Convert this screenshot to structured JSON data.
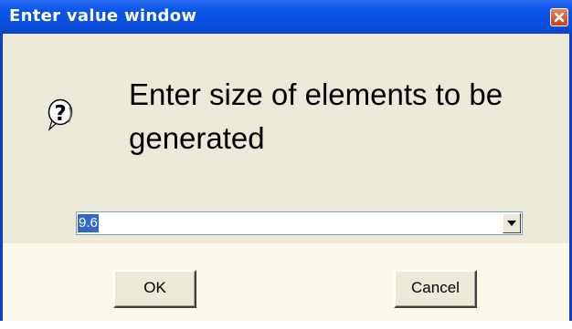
{
  "window": {
    "title": "Enter value window",
    "close_icon": "close-icon"
  },
  "dialog": {
    "icon": "question-mark-help-icon",
    "prompt": "Enter size of elements to be generated"
  },
  "size_combo": {
    "value": "9.6",
    "arrow_icon": "dropdown-arrow-icon"
  },
  "buttons": {
    "ok_label": "OK",
    "cancel_label": "Cancel"
  },
  "colors": {
    "titlebar": "#0a4fdc",
    "selection": "#316ac5",
    "close_button": "#d5552e"
  }
}
